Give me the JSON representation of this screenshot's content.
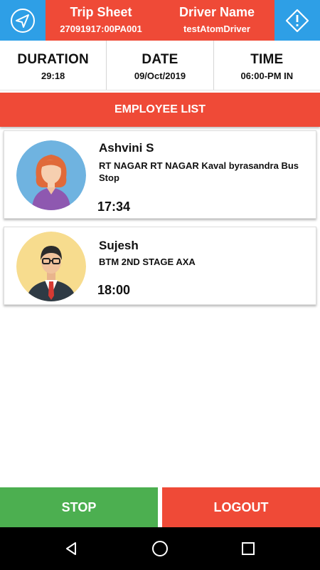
{
  "header": {
    "trip_title": "Trip Sheet",
    "trip_id": "27091917:00PA001",
    "driver_title": "Driver Name",
    "driver_name": "testAtomDriver",
    "left_icon": "navigation-icon",
    "right_icon": "warning-icon"
  },
  "info": {
    "duration_label": "DURATION",
    "duration_value": "29:18",
    "date_label": "DATE",
    "date_value": "09/Oct/2019",
    "time_label": "TIME",
    "time_value": "06:00-PM IN"
  },
  "list_title": "EMPLOYEE LIST",
  "employees": [
    {
      "name": "Ashvini S",
      "address": "RT NAGAR RT NAGAR Kaval byrasandra Bus Stop",
      "time": "17:34",
      "avatar": "female-avatar"
    },
    {
      "name": "Sujesh",
      "address": "BTM 2ND STAGE AXA",
      "time": "18:00",
      "avatar": "male-avatar"
    }
  ],
  "buttons": {
    "stop": "STOP",
    "logout": "LOGOUT"
  },
  "colors": {
    "red": "#ef4a37",
    "blue": "#2e9fe6",
    "green": "#4caf50"
  }
}
